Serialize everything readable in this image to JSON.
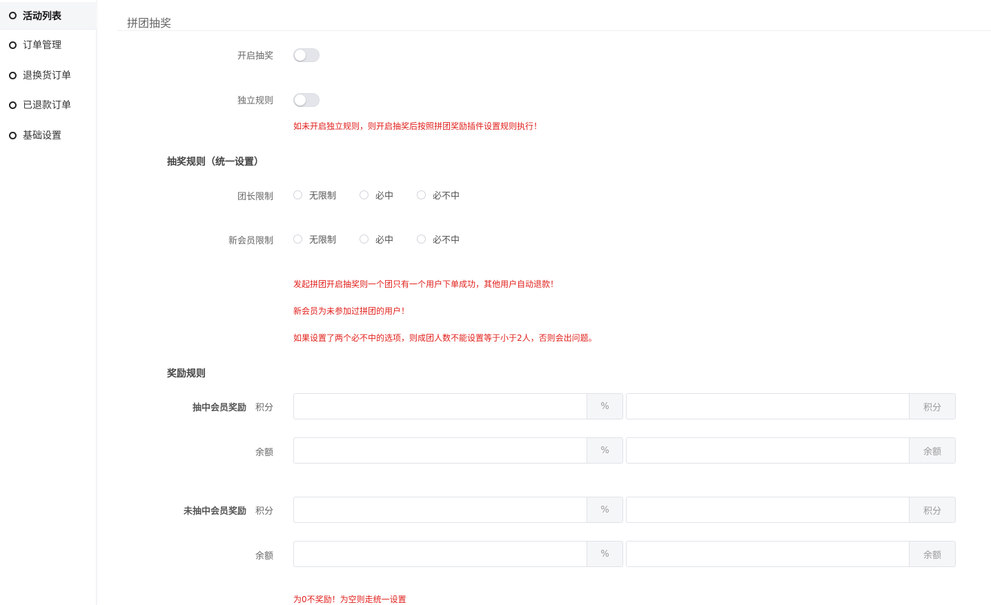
{
  "sidebar": {
    "items": [
      {
        "label": "活动列表",
        "active": true
      },
      {
        "label": "订单管理",
        "active": false
      },
      {
        "label": "退换货订单",
        "active": false
      },
      {
        "label": "已退款订单",
        "active": false
      },
      {
        "label": "基础设置",
        "active": false
      }
    ]
  },
  "page": {
    "title": "拼团抽奖"
  },
  "settings": {
    "enable_lottery": {
      "label": "开启抽奖",
      "on": false
    },
    "independent_rules": {
      "label": "独立规则",
      "on": false
    },
    "independent_hint": "如未开启独立规则，则开启抽奖后按照拼团奖励插件设置规则执行！"
  },
  "lottery_rules": {
    "heading": "抽奖规则（统一设置）",
    "leader_limit": {
      "label": "团长限制",
      "options": [
        "无限制",
        "必中",
        "必不中"
      ],
      "selected": null
    },
    "new_member_limit": {
      "label": "新会员限制",
      "options": [
        "无限制",
        "必中",
        "必不中"
      ],
      "selected": null
    },
    "notes": [
      "发起拼团开启抽奖则一个团只有一个用户下单成功，其他用户自动退款！",
      "新会员为未参加过拼团的用户！",
      "如果设置了两个必不中的选项，则成团人数不能设置等于小于2人，否则会出问题。"
    ]
  },
  "reward_rules": {
    "heading": "奖励规则",
    "winner": {
      "label": "抽中会员奖励",
      "points": {
        "label": "积分",
        "percent_value": "",
        "percent_addon": "%",
        "amount_value": "",
        "amount_addon": "积分"
      },
      "balance": {
        "label": "余额",
        "percent_value": "",
        "percent_addon": "%",
        "amount_value": "",
        "amount_addon": "余额"
      }
    },
    "loser": {
      "label": "未抽中会员奖励",
      "points": {
        "label": "积分",
        "percent_value": "",
        "percent_addon": "%",
        "amount_value": "",
        "amount_addon": "积分"
      },
      "balance": {
        "label": "余额",
        "percent_value": "",
        "percent_addon": "%",
        "amount_value": "",
        "amount_addon": "余额"
      }
    },
    "footer_hint": "为0不奖励！为空则走统一设置"
  },
  "colors": {
    "hint": "#e0201b",
    "switch_off": "#e3e5ea",
    "addon_bg": "#f5f6f8"
  }
}
